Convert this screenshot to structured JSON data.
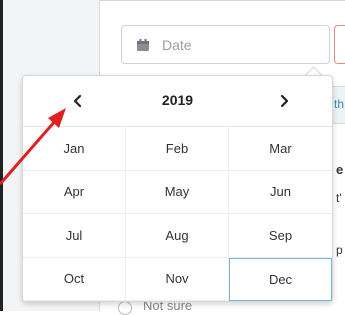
{
  "date_field": {
    "placeholder": "Date",
    "icon": "calendar-icon"
  },
  "picker": {
    "year": "2019",
    "prev_icon": "chevron-left-icon",
    "next_icon": "chevron-right-icon",
    "months": [
      "Jan",
      "Feb",
      "Mar",
      "Apr",
      "May",
      "Jun",
      "Jul",
      "Aug",
      "Sep",
      "Oct",
      "Nov",
      "Dec"
    ],
    "selected_month": "Dec"
  },
  "background": {
    "fragments": [
      "th",
      "e",
      "t'",
      "p"
    ],
    "radio_label": "Not sure"
  },
  "colors": {
    "annotation_arrow": "#e02020",
    "selected_border": "#7fb6d6"
  }
}
